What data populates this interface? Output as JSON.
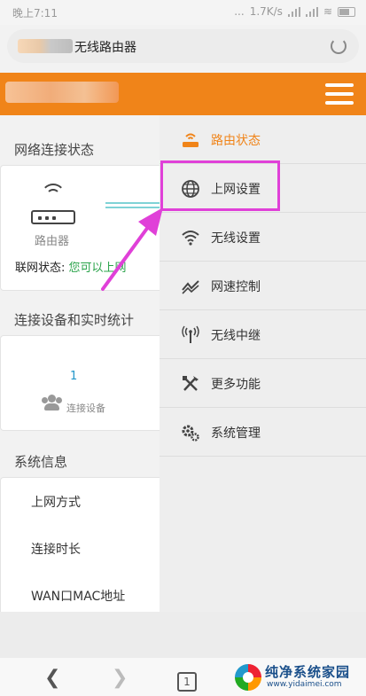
{
  "status_bar": {
    "time": "晚上7:11",
    "dots": "...",
    "speed": "1.7K/s"
  },
  "browser": {
    "page_title": "无线路由器"
  },
  "sections": {
    "network": {
      "title": "网络连接状态",
      "router_label": "路由器",
      "status_prefix": "联网状态:",
      "status_value": "您可以上网"
    },
    "devices": {
      "title": "连接设备和实时统计",
      "count": "1",
      "label": "连接设备"
    },
    "sysinfo": {
      "title": "系统信息",
      "rows": [
        "上网方式",
        "连接时长",
        "WAN口MAC地址"
      ]
    }
  },
  "menu": {
    "items": [
      {
        "label": "路由状态",
        "icon": "router-status-icon",
        "active": true
      },
      {
        "label": "上网设置",
        "icon": "globe-icon",
        "active": false
      },
      {
        "label": "无线设置",
        "icon": "wifi-icon",
        "active": false
      },
      {
        "label": "网速控制",
        "icon": "speed-control-icon",
        "active": false
      },
      {
        "label": "无线中继",
        "icon": "antenna-icon",
        "active": false
      },
      {
        "label": "更多功能",
        "icon": "tools-icon",
        "active": false
      },
      {
        "label": "系统管理",
        "icon": "gears-icon",
        "active": false
      }
    ]
  },
  "navbar": {
    "tabs_count": "1"
  },
  "watermark": {
    "name": "纯净系统家园",
    "url": "www.yidaimei.com"
  },
  "colors": {
    "accent": "#f08419",
    "highlight": "#e040d8",
    "ok": "#2aa34a"
  }
}
